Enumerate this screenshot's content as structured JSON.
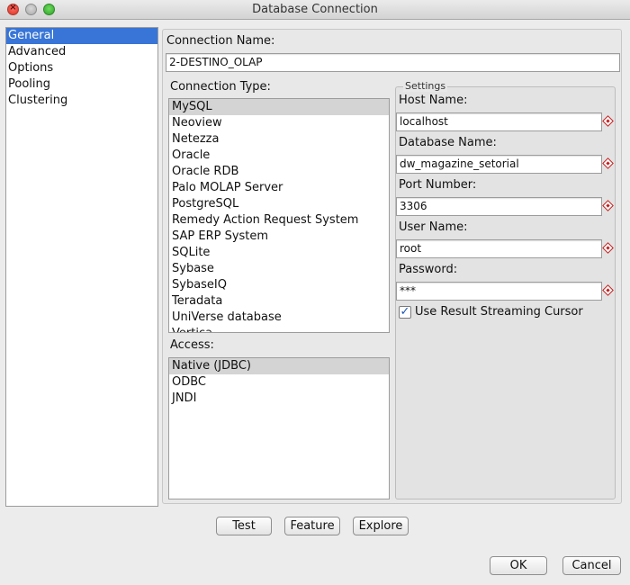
{
  "window": {
    "title": "Database Connection"
  },
  "nav": {
    "items": [
      {
        "label": "General",
        "selected": true
      },
      {
        "label": "Advanced",
        "selected": false
      },
      {
        "label": "Options",
        "selected": false
      },
      {
        "label": "Pooling",
        "selected": false
      },
      {
        "label": "Clustering",
        "selected": false
      }
    ]
  },
  "general": {
    "connection_name_label": "Connection Name:",
    "connection_name_value": "2-DESTINO_OLAP",
    "connection_type_label": "Connection Type:",
    "connection_types": [
      "MySQL",
      "Neoview",
      "Netezza",
      "Oracle",
      "Oracle RDB",
      "Palo MOLAP Server",
      "PostgreSQL",
      "Remedy Action Request System",
      "SAP ERP System",
      "SQLite",
      "Sybase",
      "SybaseIQ",
      "Teradata",
      "UniVerse database",
      "Vertica"
    ],
    "connection_type_selected": "MySQL",
    "access_label": "Access:",
    "access_options": [
      "Native (JDBC)",
      "ODBC",
      "JNDI"
    ],
    "access_selected": "Native (JDBC)"
  },
  "settings": {
    "title": "Settings",
    "host_name_label": "Host Name:",
    "host_name_value": "localhost",
    "database_name_label": "Database Name:",
    "database_name_value": "dw_magazine_setorial",
    "port_number_label": "Port Number:",
    "port_number_value": "3306",
    "user_name_label": "User Name:",
    "user_name_value": "root",
    "password_label": "Password:",
    "password_value": "***",
    "streaming_cursor_label": "Use Result Streaming Cursor",
    "streaming_cursor_checked": true
  },
  "buttons": {
    "test": "Test",
    "feature": "Feature",
    "explore": "Explore",
    "ok": "OK",
    "cancel": "Cancel"
  },
  "icons": {
    "close": "close-icon",
    "minimize": "minimize-icon",
    "maximize": "maximize-icon",
    "required": "required-field-icon",
    "check": "checkmark-icon"
  },
  "colors": {
    "nav_selected": "#3875d7",
    "list_selected": "#d4d4d4",
    "required_marker": "#c41a1a"
  }
}
